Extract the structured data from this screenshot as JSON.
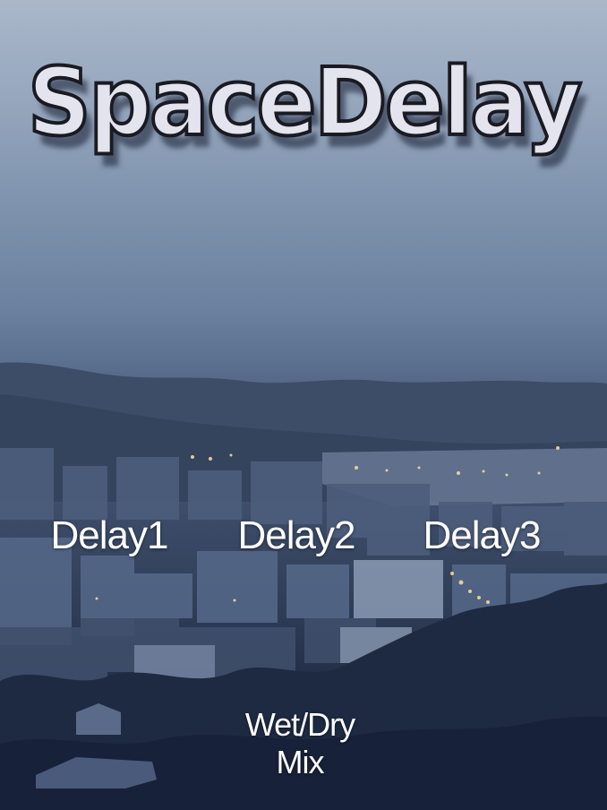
{
  "app": {
    "title": "SpaceDelay"
  },
  "controls": {
    "delay1": "Delay1",
    "delay2": "Delay2",
    "delay3": "Delay3",
    "mix_line1": "Wet/Dry",
    "mix_line2": "Mix"
  },
  "colors": {
    "title_fill": "#e4e4ef",
    "title_outline": "#1a1a22",
    "label": "#ffffff"
  }
}
